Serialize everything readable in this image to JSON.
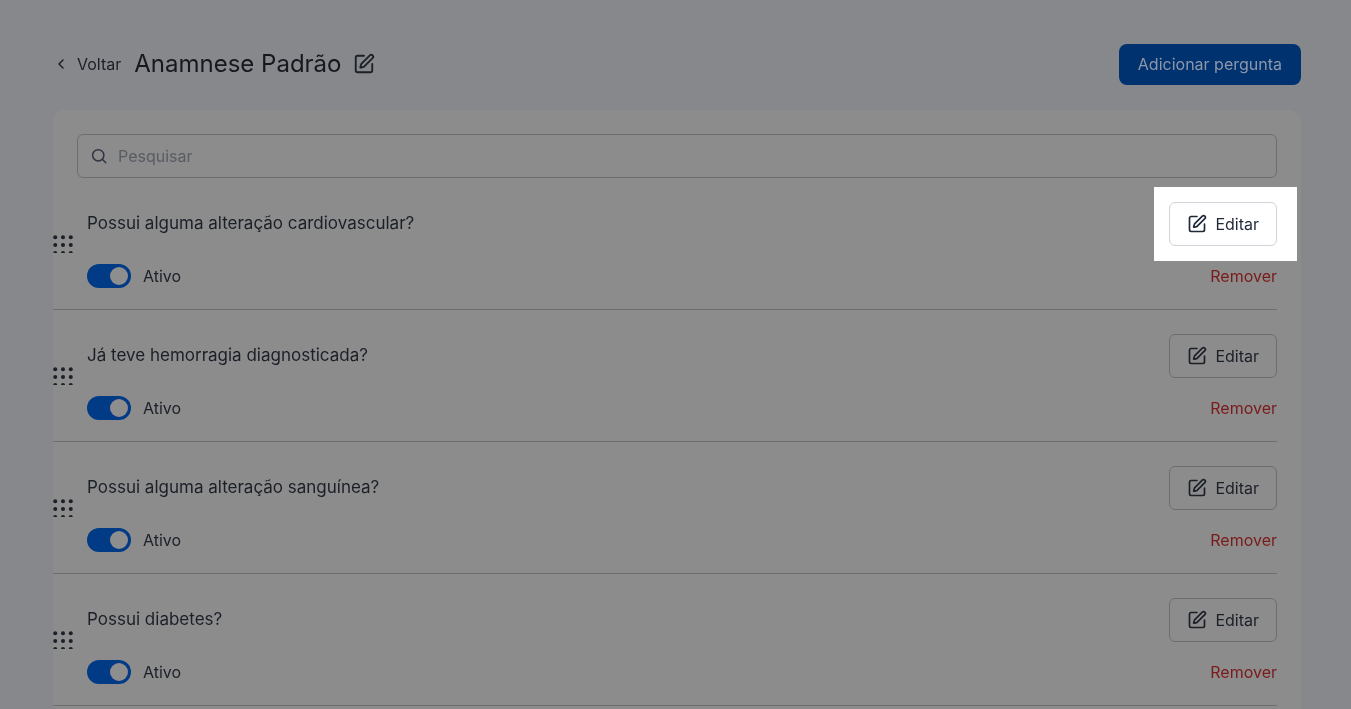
{
  "header": {
    "back_label": "Voltar",
    "title": "Anamnese Padrão",
    "add_button": "Adicionar pergunta"
  },
  "search": {
    "placeholder": "Pesquisar"
  },
  "questions": [
    {
      "text": "Possui alguma alteração cardiovascular?",
      "edit_label": "Editar",
      "edit_highlighted": true,
      "on": true,
      "status_label": "Ativo",
      "remove_label": "Remover"
    },
    {
      "text": "Já teve hemorragia diagnosticada?",
      "edit_label": "Editar",
      "edit_highlighted": false,
      "on": true,
      "status_label": "Ativo",
      "remove_label": "Remover"
    },
    {
      "text": "Possui alguma alteração sanguínea?",
      "edit_label": "Editar",
      "edit_highlighted": false,
      "on": true,
      "status_label": "Ativo",
      "remove_label": "Remover"
    },
    {
      "text": "Possui diabetes?",
      "edit_label": "Editar",
      "edit_highlighted": false,
      "on": true,
      "status_label": "Ativo",
      "remove_label": "Remover"
    }
  ]
}
